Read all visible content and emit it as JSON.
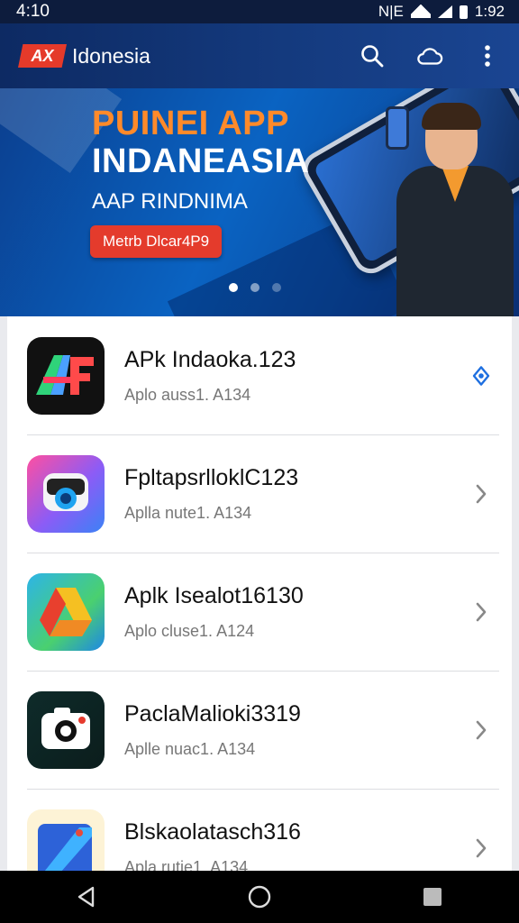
{
  "status_bar": {
    "time": "4:10",
    "right_text": "1:92",
    "indicators": "N|E"
  },
  "app_bar": {
    "logo_text": "AX",
    "title": "Idonesia",
    "actions": [
      "search-icon",
      "cloud-icon",
      "more-vert-icon"
    ]
  },
  "banner": {
    "title_line1": "PUINEI APP",
    "title_line2": "INDANEASIA",
    "subtitle": "AAP RINDNIMA",
    "button_label": "Metrb Dlcar4P9",
    "dots": 3,
    "active_dot": 0,
    "colors": {
      "title1": "#ff8a2a",
      "button": "#e43b2c"
    }
  },
  "apps": [
    {
      "name": "APk Indaoka.123",
      "meta": "Aplo auss1. A134",
      "icon": "af-logo-icon",
      "action": "download-icon"
    },
    {
      "name": "FpltapsrlloklC123",
      "meta": "Aplla nute1. A134",
      "icon": "camera-lens-icon",
      "action": "chevron-right-icon"
    },
    {
      "name": "Aplk Isealot16130",
      "meta": "Aplo cluse1. A124",
      "icon": "drive-icon",
      "action": "chevron-right-icon"
    },
    {
      "name": "PaclaMalioki3319",
      "meta": "Aplle nuac1. A134",
      "icon": "camera-icon",
      "action": "chevron-right-icon"
    },
    {
      "name": "Blskaolatasch316",
      "meta": "Apla rutie1. A134",
      "icon": "notes-icon",
      "action": "chevron-right-icon"
    }
  ],
  "nav_bar": [
    "back-icon",
    "home-icon",
    "recents-icon"
  ]
}
